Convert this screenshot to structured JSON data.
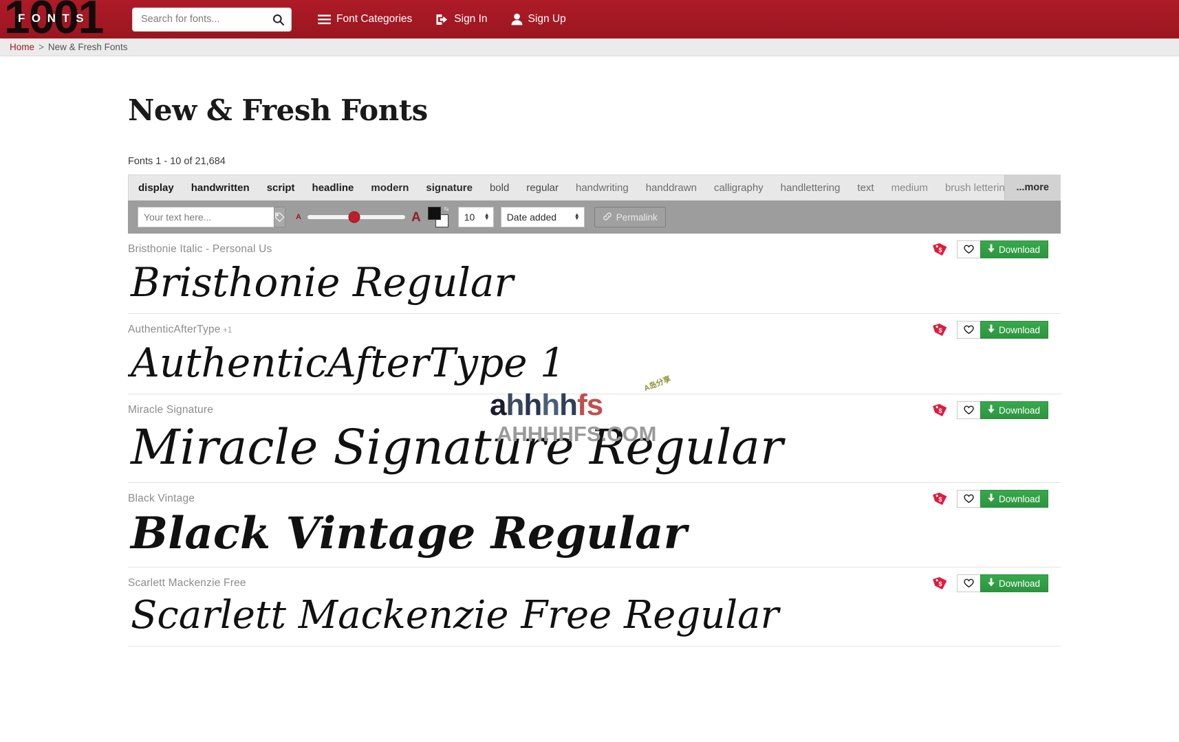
{
  "header": {
    "logo": {
      "digits": "1001",
      "word": "FONTS"
    },
    "search": {
      "placeholder": "Search for fonts...",
      "value": "",
      "icon": "search-icon"
    },
    "nav": [
      {
        "label": "Font Categories",
        "icon": "hamburger-icon"
      },
      {
        "label": "Sign In",
        "icon": "sign-in-icon"
      },
      {
        "label": "Sign Up",
        "icon": "user-icon"
      }
    ]
  },
  "breadcrumb": {
    "home": "Home",
    "separator": ">",
    "current": "New & Fresh Fonts"
  },
  "main": {
    "title": "New & Fresh Fonts",
    "count_text": "Fonts 1 - 10 of 21,684",
    "tags": [
      {
        "label": "display",
        "weight": "w1"
      },
      {
        "label": "handwritten",
        "weight": "w1"
      },
      {
        "label": "script",
        "weight": "w1"
      },
      {
        "label": "headline",
        "weight": "w1"
      },
      {
        "label": "modern",
        "weight": "w2"
      },
      {
        "label": "signature",
        "weight": "w2"
      },
      {
        "label": "bold",
        "weight": "w3"
      },
      {
        "label": "regular",
        "weight": "w3"
      },
      {
        "label": "handwriting",
        "weight": "w4"
      },
      {
        "label": "handdrawn",
        "weight": "w4"
      },
      {
        "label": "calligraphy",
        "weight": "w4"
      },
      {
        "label": "handlettering",
        "weight": "w4"
      },
      {
        "label": "text",
        "weight": "w4"
      },
      {
        "label": "medium",
        "weight": "w5"
      },
      {
        "label": "brush lettering",
        "weight": "w5"
      }
    ],
    "tags_more": "...more",
    "controls": {
      "text_placeholder": "Your text here...",
      "text_value": "",
      "tag_button_icon": "tag-icon",
      "size_small_label": "A",
      "size_large_label": "A",
      "slider_value": "48",
      "color_fg": "#101010",
      "color_bg": "#ffffff",
      "per_page_value": "10",
      "sort_value": "Date added",
      "permalink_label": "Permalink",
      "permalink_icon": "link-icon"
    }
  },
  "fonts": [
    {
      "name": "Bristhonie Italic - Personal Us",
      "suffix": "",
      "preview": "Bristhonie  Regular",
      "preview_size": "58",
      "preview_style": "italic",
      "price_icon": "price-tag-icon",
      "favorite_icon": "heart-icon",
      "download_label": "Download",
      "download_icon": "download-arrow-icon"
    },
    {
      "name": "AuthenticAfterType",
      "suffix": "+1",
      "preview": "AuthenticAfterType 1",
      "preview_size": "58",
      "preview_style": "italic",
      "price_icon": "price-tag-icon",
      "favorite_icon": "heart-icon",
      "download_label": "Download",
      "download_icon": "download-arrow-icon"
    },
    {
      "name": "Miracle Signature",
      "suffix": "",
      "preview": "Miracle Signature Regular",
      "preview_size": "70",
      "preview_style": "italic",
      "price_icon": "price-tag-icon",
      "favorite_icon": "heart-icon",
      "download_label": "Download",
      "download_icon": "download-arrow-icon"
    },
    {
      "name": "Black Vintage",
      "suffix": "",
      "preview": "Black Vintage Regular",
      "preview_size": "64",
      "preview_style": "italic-bold",
      "price_icon": "price-tag-icon",
      "favorite_icon": "heart-icon",
      "download_label": "Download",
      "download_icon": "download-arrow-icon"
    },
    {
      "name": "Scarlett Mackenzie Free",
      "suffix": "",
      "preview": "Scarlett Mackenzie Free Regular",
      "preview_size": "56",
      "preview_style": "italic",
      "price_icon": "price-tag-icon",
      "favorite_icon": "heart-icon",
      "download_label": "Download",
      "download_icon": "download-arrow-icon"
    }
  ],
  "watermark": {
    "line1_parts": [
      {
        "text": "a",
        "color": "#1c1c2e"
      },
      {
        "text": "h",
        "color": "#3c4a5e"
      },
      {
        "text": "h",
        "color": "#2a3550"
      },
      {
        "text": "h",
        "color": "#4a5f78"
      },
      {
        "text": "h",
        "color": "#2f3f55"
      },
      {
        "text": "f",
        "color": "#c0504d"
      },
      {
        "text": "s",
        "color": "#c0504d"
      }
    ],
    "line2": "AHHHHFS.COM",
    "badge": "A岛分享"
  },
  "colors": {
    "brand_red": "#a01722",
    "download_green": "#2f9e44",
    "tag_red": "#e01b3c",
    "toolbar_gray": "#9d9d9d",
    "tagbar_gray": "#e8e8e8"
  }
}
